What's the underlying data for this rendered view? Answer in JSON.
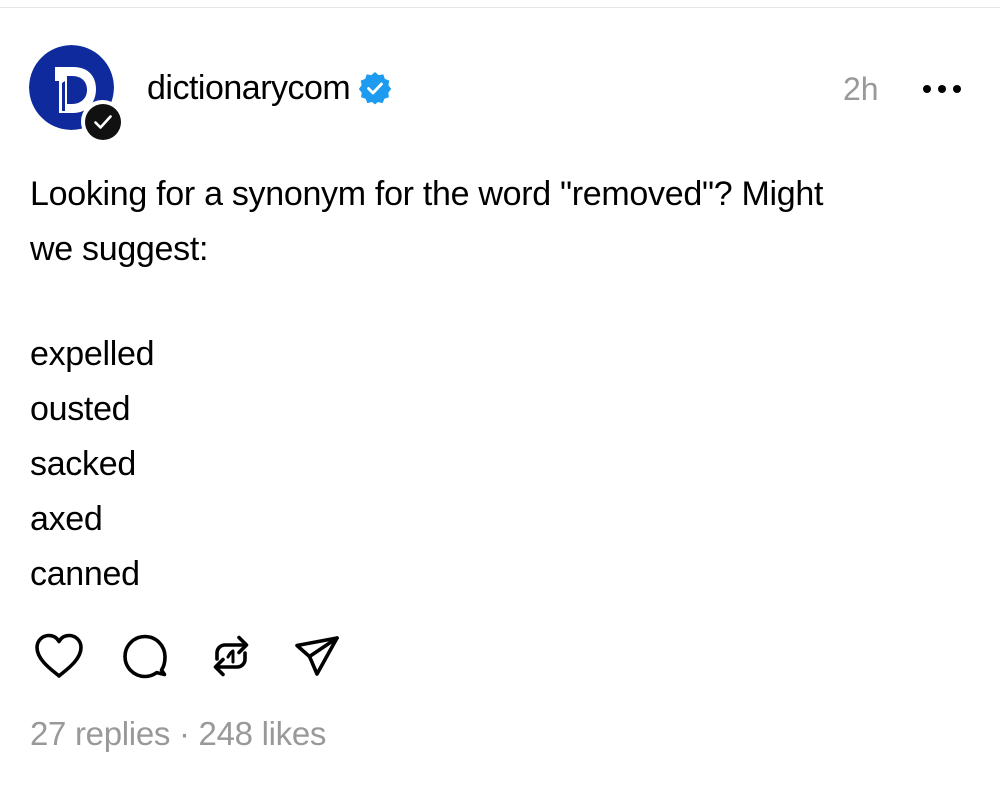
{
  "post": {
    "author": {
      "username": "dictionarycom",
      "avatar_icon": "dictionary-d-logo",
      "verified_icon": "verified-badge-icon",
      "brand_color": "#0f2a9c",
      "verified_color": "#1d9bf0"
    },
    "timestamp": "2h",
    "more_icon": "more-horizontal-icon",
    "text_lines": [
      "Looking for a synonym for the word \"removed\"? Might",
      "we suggest:"
    ],
    "words": [
      "expelled",
      "ousted",
      "sacked",
      "axed",
      "canned"
    ],
    "actions": [
      {
        "icon": "heart-icon"
      },
      {
        "icon": "comment-icon"
      },
      {
        "icon": "repost-icon"
      },
      {
        "icon": "share-icon"
      }
    ],
    "stats": {
      "replies": "27 replies",
      "separator": "·",
      "likes": "248 likes"
    }
  }
}
